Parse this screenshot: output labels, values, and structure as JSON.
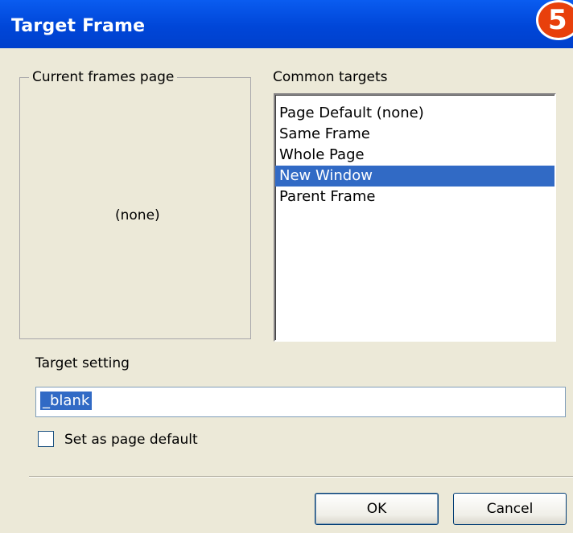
{
  "window": {
    "title": "Target Frame"
  },
  "step_badge": "5",
  "frames_group": {
    "legend": "Current frames page",
    "value": "(none)"
  },
  "common_targets": {
    "label": "Common targets",
    "items": [
      "Page Default (none)",
      "Same Frame",
      "Whole Page",
      "New Window",
      "Parent Frame"
    ],
    "selected": "New Window"
  },
  "target_setting": {
    "label": "Target setting",
    "value": "_blank"
  },
  "page_default": {
    "label": "Set as page default",
    "checked": false
  },
  "buttons": {
    "ok": "OK",
    "cancel": "Cancel"
  },
  "colors": {
    "titlebar": "#0046d8",
    "selection": "#316ac5",
    "dialog_bg": "#ece9d8",
    "badge": "#e8400c"
  }
}
